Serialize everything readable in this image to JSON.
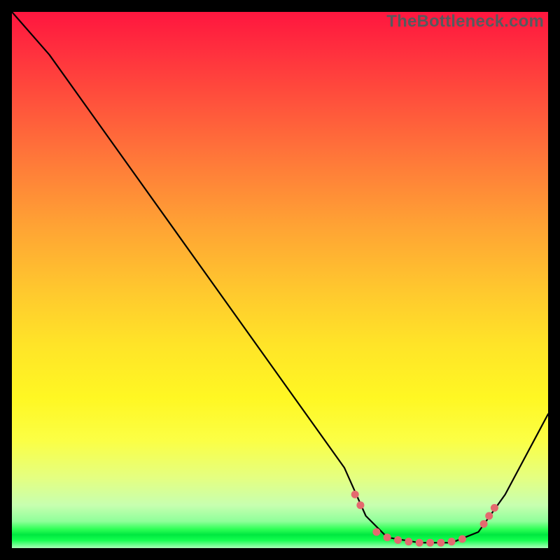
{
  "watermark": "TheBottleneck.com",
  "chart_data": {
    "type": "line",
    "title": "",
    "xlabel": "",
    "ylabel": "",
    "xlim": [
      0,
      100
    ],
    "ylim": [
      0,
      100
    ],
    "grid": false,
    "legend": false,
    "series": [
      {
        "name": "curve",
        "points": [
          {
            "x": 0,
            "y": 100
          },
          {
            "x": 7,
            "y": 92
          },
          {
            "x": 62,
            "y": 15
          },
          {
            "x": 66,
            "y": 6
          },
          {
            "x": 70,
            "y": 2
          },
          {
            "x": 76,
            "y": 1
          },
          {
            "x": 82,
            "y": 1
          },
          {
            "x": 87,
            "y": 3
          },
          {
            "x": 92,
            "y": 10
          },
          {
            "x": 100,
            "y": 25
          }
        ]
      }
    ],
    "markers": [
      {
        "x": 64,
        "y": 10
      },
      {
        "x": 65,
        "y": 8
      },
      {
        "x": 68,
        "y": 3
      },
      {
        "x": 70,
        "y": 2
      },
      {
        "x": 72,
        "y": 1.5
      },
      {
        "x": 74,
        "y": 1.2
      },
      {
        "x": 76,
        "y": 1
      },
      {
        "x": 78,
        "y": 1
      },
      {
        "x": 80,
        "y": 1
      },
      {
        "x": 82,
        "y": 1.2
      },
      {
        "x": 84,
        "y": 1.7
      },
      {
        "x": 88,
        "y": 4.5
      },
      {
        "x": 89,
        "y": 6
      },
      {
        "x": 90,
        "y": 7.5
      }
    ],
    "marker_radius": 5.5,
    "colors": {
      "line": "#000000",
      "marker": "#e46a6f",
      "gradient_top": "#ff163f",
      "gradient_mid": "#ffe428",
      "gradient_bottom_band": "#00e840"
    }
  }
}
